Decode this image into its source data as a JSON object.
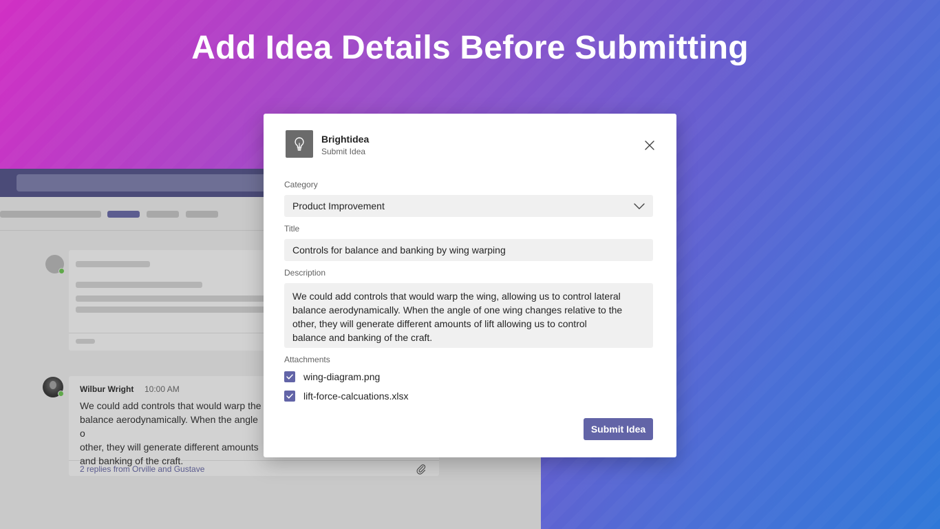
{
  "headline": "Add Idea Details Before Submitting",
  "colors": {
    "accent": "#6264a7",
    "gradient_start": "#d12fc4",
    "gradient_end": "#2f78d8"
  },
  "background_app": {
    "message": {
      "author": "Wilbur Wright",
      "time": "10:00 AM",
      "body": "We could add controls that would warp the\nbalance aerodynamically. When the angle o\nother, they will generate different amounts\nand banking of the craft.",
      "replies": "2 replies from Orville and Gustave",
      "attachment_icon": "paperclip-icon"
    }
  },
  "modal": {
    "app_icon": "lightbulb-icon",
    "app_name": "Brightidea",
    "app_subtitle": "Submit Idea",
    "close_icon": "close-icon",
    "category": {
      "label": "Category",
      "value": "Product Improvement",
      "icon": "chevron-down-icon"
    },
    "title": {
      "label": "Title",
      "value": "Controls for balance and banking by wing warping"
    },
    "description": {
      "label": "Description",
      "value": "We could add controls that would warp the wing, allowing us to control lateral\nbalance aerodynamically. When the angle of one wing changes relative to the\nother, they will generate different amounts of lift allowing us to control\nbalance and banking of the craft."
    },
    "attachments": {
      "label": "Attachments",
      "items": [
        {
          "name": "wing-diagram.png",
          "checked": true
        },
        {
          "name": "lift-force-calcuations.xlsx",
          "checked": true
        }
      ]
    },
    "submit_label": "Submit Idea"
  }
}
